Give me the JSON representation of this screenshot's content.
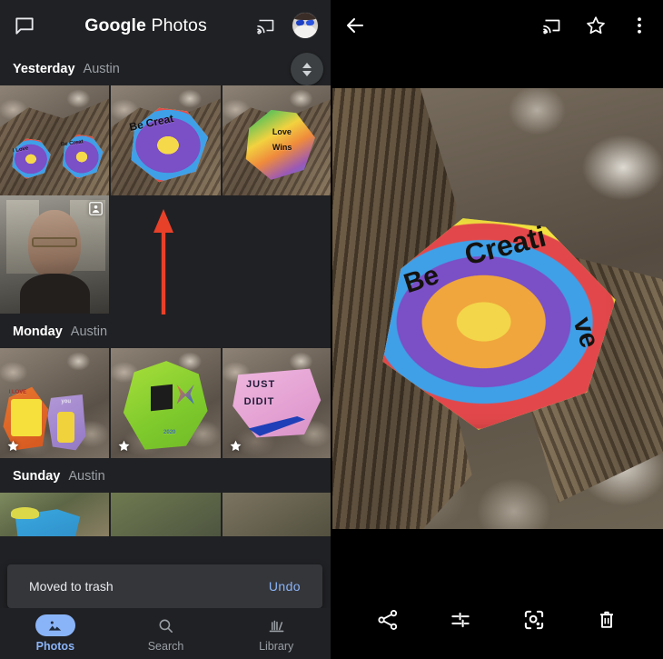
{
  "app": {
    "title_bold": "Google",
    "title_light": "Photos",
    "accent_blue": "#8ab4f8",
    "surface": "#202124",
    "snackbar_surface": "#35363a",
    "annotation_color": "#e8412a"
  },
  "left_pane": {
    "topbar": {
      "chat_icon": "chat-bubble-icon",
      "cast_icon": "cast-icon",
      "avatar_icon": "account-avatar"
    },
    "scroll_indicator": {
      "up_icon": "triangle-up-icon",
      "down_icon": "triangle-down-icon"
    },
    "sections": [
      {
        "day": "Yesterday",
        "place": "Austin",
        "rows": [
          [
            {
              "name": "photo-rocks-pair",
              "caption": "I Love / Be Creative painted rocks",
              "starred": false,
              "portrait": false
            },
            {
              "name": "photo-be-creative",
              "caption": "Be Creative",
              "starred": false,
              "portrait": false
            },
            {
              "name": "photo-love-wins",
              "caption": "Love Wins",
              "starred": false,
              "portrait": false
            }
          ],
          [
            {
              "name": "photo-selfie-portrait",
              "caption": "Portrait selfie",
              "starred": false,
              "portrait": true
            }
          ]
        ]
      },
      {
        "day": "Monday",
        "place": "Austin",
        "rows": [
          [
            {
              "name": "photo-spongebob-minion",
              "caption": "I Love / you rocks",
              "starred": true,
              "portrait": false
            },
            {
              "name": "photo-green-cube",
              "caption": "Green rock with cube and butterfly",
              "starred": true,
              "portrait": false
            },
            {
              "name": "photo-just-did-it",
              "caption": "Just Did It",
              "starred": true,
              "portrait": false
            }
          ]
        ]
      },
      {
        "day": "Sunday",
        "place": "Austin",
        "rows": [
          [
            {
              "name": "photo-blue-rock",
              "caption": "Blue painted rock",
              "starred": false,
              "portrait": false
            }
          ]
        ]
      }
    ],
    "snackbar": {
      "message": "Moved to trash",
      "action": "Undo"
    },
    "bottom_nav": [
      {
        "label": "Photos",
        "icon": "photos-icon",
        "active": true
      },
      {
        "label": "Search",
        "icon": "search-icon",
        "active": false
      },
      {
        "label": "Library",
        "icon": "library-icon",
        "active": false
      }
    ]
  },
  "right_pane": {
    "topbar": {
      "back_icon": "back-arrow-icon",
      "cast_icon": "cast-icon",
      "favorite_icon": "star-outline-icon",
      "overflow_icon": "more-vert-icon"
    },
    "photo": {
      "name": "photo-be-creative-full",
      "caption": "Be Creative",
      "alt": "Rainbow painted rock reading Be Creative resting on driftwood"
    },
    "bottom_actions": [
      {
        "label": "Share",
        "icon": "share-icon"
      },
      {
        "label": "Edit",
        "icon": "edit-sliders-icon"
      },
      {
        "label": "Lens",
        "icon": "google-lens-icon"
      },
      {
        "label": "Delete",
        "icon": "trash-icon"
      }
    ]
  },
  "annotations": [
    {
      "name": "arrow-up-annotation",
      "direction": "up",
      "target": "photo-grid-empty-slot"
    },
    {
      "name": "arrow-down-annotation",
      "direction": "down",
      "target": "edit-button"
    }
  ]
}
